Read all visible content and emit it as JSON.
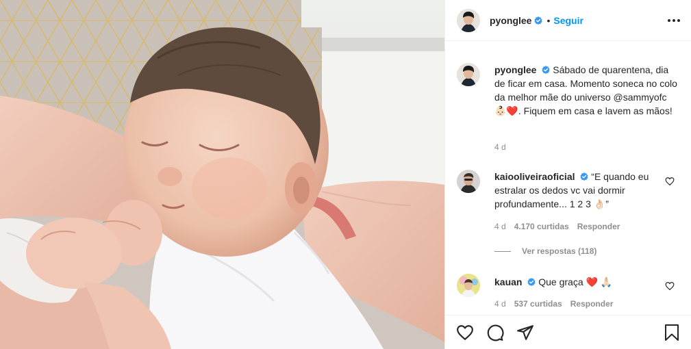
{
  "post": {
    "author": "pyonglee",
    "follow_label": "Seguir",
    "dot": "•",
    "caption": "Sábado de quarentena, dia de ficar em casa. Momento soneca no colo da melhor mãe do universo @sammyofc 👶🏻❤️. Fiquem em casa e lavem as mãos!",
    "time": "4 d"
  },
  "comments": [
    {
      "username": "kaiooliveiraoficial",
      "text": "“E quando eu estralar os dedos vc vai dormir profundamente... 1 2 3 👌🏻”",
      "time": "4 d",
      "likes": "4.170 curtidas",
      "reply_label": "Responder",
      "view_replies": "Ver respostas (118)"
    },
    {
      "username": "kauan",
      "text": "Que graça ❤️ 🙏🏻",
      "time": "4 d",
      "likes": "537 curtidas",
      "reply_label": "Responder"
    }
  ],
  "icons": {
    "verified": "verified-badge-icon",
    "more": "more-options-icon",
    "like": "heart-icon",
    "comment": "comment-icon",
    "share": "share-icon",
    "save": "bookmark-icon"
  },
  "colors": {
    "accent": "#0095f6",
    "text": "#262626",
    "muted": "#8e8e8e",
    "border": "#efefef"
  }
}
